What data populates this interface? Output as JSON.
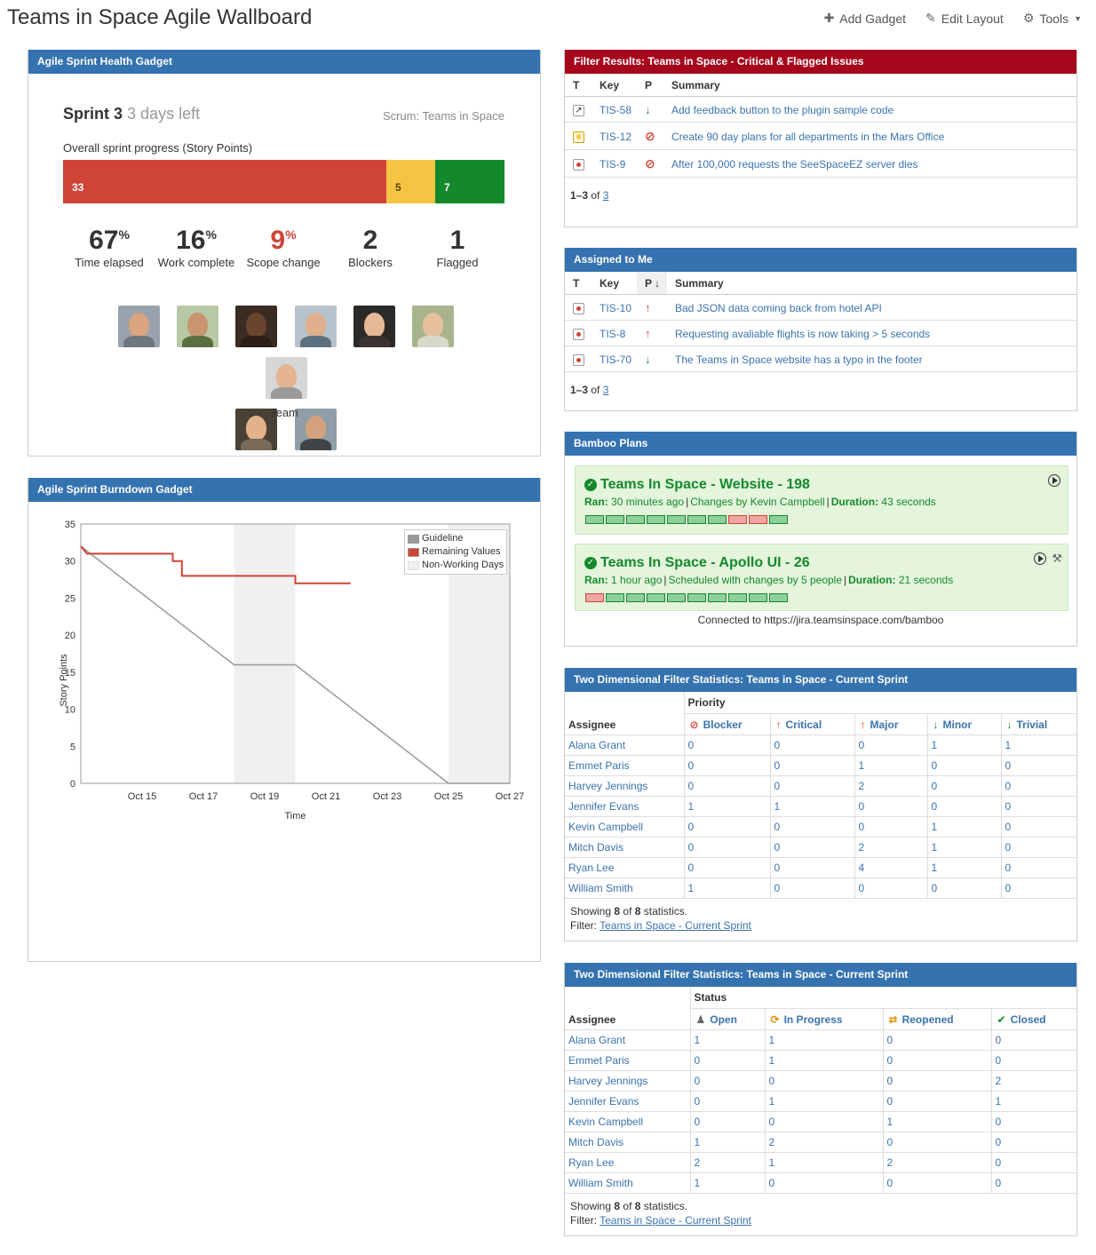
{
  "page": {
    "title": "Teams in Space Agile Wallboard",
    "actions": [
      {
        "icon": "plus-icon",
        "label": "Add Gadget"
      },
      {
        "icon": "pencil-icon",
        "label": "Edit Layout"
      },
      {
        "icon": "gear-icon",
        "label": "Tools"
      }
    ]
  },
  "health": {
    "header": "Agile Sprint Health Gadget",
    "sprint": "Sprint 3",
    "days_left": "3 days left",
    "board": "Scrum: Teams in Space",
    "progress_label": "Overall sprint progress (Story Points)",
    "progress": {
      "todo": 33,
      "in_progress": 5,
      "done": 7
    },
    "progress_colors": {
      "todo": "#d04437",
      "in_progress": "#f6c342",
      "done": "#14892c"
    },
    "stats": [
      {
        "value": "67",
        "unit": "%",
        "label": "Time elapsed"
      },
      {
        "value": "16",
        "unit": "%",
        "label": "Work complete"
      },
      {
        "value": "9",
        "unit": "%",
        "label": "Scope change"
      },
      {
        "value": "2",
        "unit": "",
        "label": "Blockers"
      },
      {
        "value": "1",
        "unit": "",
        "label": "Flagged"
      }
    ],
    "team_label": "Team"
  },
  "burndown": {
    "header": "Agile Sprint Burndown Gadget",
    "legend": [
      "Guideline",
      "Remaining Values",
      "Non-Working Days"
    ]
  },
  "chart_data": {
    "type": "line",
    "xlabel": "Time",
    "ylabel": "Story Points",
    "ylim": [
      0,
      35
    ],
    "yticks": [
      0,
      5,
      10,
      15,
      20,
      25,
      30,
      35
    ],
    "xticks": [
      "Oct 15",
      "Oct 17",
      "Oct 19",
      "Oct 21",
      "Oct 23",
      "Oct 25",
      "Oct 27"
    ],
    "x_start": "Oct 13",
    "x_end": "Oct 27",
    "non_working_days": [
      [
        "Oct 18",
        "Oct 20"
      ],
      [
        "Oct 25",
        "Oct 27"
      ]
    ],
    "series": [
      {
        "name": "Guideline",
        "color": "#999999",
        "points": [
          [
            "Oct 13",
            32
          ],
          [
            "Oct 18",
            16
          ],
          [
            "Oct 20",
            16
          ],
          [
            "Oct 25",
            0
          ],
          [
            "Oct 27",
            0
          ]
        ]
      },
      {
        "name": "Remaining Values",
        "color": "#d04437",
        "points": [
          [
            "Oct 13",
            32
          ],
          [
            "Oct 13.2",
            31
          ],
          [
            "Oct 16",
            31
          ],
          [
            "Oct 16",
            30
          ],
          [
            "Oct 16.3",
            30
          ],
          [
            "Oct 16.3",
            28
          ],
          [
            "Oct 20",
            28
          ],
          [
            "Oct 20",
            27
          ],
          [
            "Oct 21.8",
            27
          ]
        ]
      }
    ]
  },
  "filter_results": {
    "header": "Filter Results: Teams in Space - Critical & Flagged Issues",
    "columns": [
      "T",
      "Key",
      "P",
      "Summary"
    ],
    "rows": [
      {
        "type": "improvement",
        "key": "TIS-58",
        "priority": "minor",
        "summary": "Add feedback button to the plugin sample code"
      },
      {
        "type": "idea",
        "key": "TIS-12",
        "priority": "blocker",
        "summary": "Create 90 day plans for all departments in the Mars Office"
      },
      {
        "type": "bug",
        "key": "TIS-9",
        "priority": "blocker",
        "summary": "After 100,000 requests the SeeSpaceEZ server dies"
      }
    ],
    "pager_range": "1–3",
    "pager_of": "of",
    "pager_total": "3"
  },
  "assigned": {
    "header": "Assigned to Me",
    "columns": [
      "T",
      "Key",
      "P",
      "Summary"
    ],
    "rows": [
      {
        "type": "bug",
        "key": "TIS-10",
        "priority": "major",
        "summary": "Bad JSON data coming back from hotel API"
      },
      {
        "type": "bug",
        "key": "TIS-8",
        "priority": "major",
        "summary": "Requesting avaliable flights is now taking > 5 seconds"
      },
      {
        "type": "bug",
        "key": "TIS-70",
        "priority": "minor",
        "summary": "The Teams in Space website has a typo in the footer"
      }
    ],
    "pager_range": "1–3",
    "pager_of": "of",
    "pager_total": "3"
  },
  "bamboo": {
    "header": "Bamboo Plans",
    "plans": [
      {
        "title": "Teams In Space - Website - 198",
        "ran_label": "Ran:",
        "ran": "30 minutes ago",
        "changes": "Changes by Kevin Campbell",
        "duration_label": "Duration:",
        "duration": "43 seconds",
        "builds": [
          "ok",
          "ok",
          "ok",
          "ok",
          "ok",
          "ok",
          "ok",
          "fail",
          "fail",
          "ok"
        ]
      },
      {
        "title": "Teams In Space - Apollo UI - 26",
        "ran_label": "Ran:",
        "ran": "1 hour ago",
        "changes": "Scheduled with changes by 5 people",
        "duration_label": "Duration:",
        "duration": "21 seconds",
        "builds": [
          "fail",
          "ok",
          "ok",
          "ok",
          "ok",
          "ok",
          "ok",
          "ok",
          "ok",
          "ok"
        ]
      }
    ],
    "footer": "Connected to https://jira.teamsinspace.com/bamboo"
  },
  "stats_priority": {
    "header": "Two Dimensional Filter Statistics: Teams in Space - Current Sprint",
    "group_label": "Priority",
    "assignee_label": "Assignee",
    "columns": [
      "Blocker",
      "Critical",
      "Major",
      "Minor",
      "Trivial"
    ],
    "rows": [
      {
        "name": "Alana Grant",
        "values": [
          "0",
          "0",
          "0",
          "1",
          "1"
        ]
      },
      {
        "name": "Emmet Paris",
        "values": [
          "0",
          "0",
          "1",
          "0",
          "0"
        ]
      },
      {
        "name": "Harvey Jennings",
        "values": [
          "0",
          "0",
          "2",
          "0",
          "0"
        ]
      },
      {
        "name": "Jennifer Evans",
        "values": [
          "1",
          "1",
          "0",
          "0",
          "0"
        ]
      },
      {
        "name": "Kevin Campbell",
        "values": [
          "0",
          "0",
          "0",
          "1",
          "0"
        ]
      },
      {
        "name": "Mitch Davis",
        "values": [
          "0",
          "0",
          "2",
          "1",
          "0"
        ]
      },
      {
        "name": "Ryan Lee",
        "values": [
          "0",
          "0",
          "4",
          "1",
          "0"
        ]
      },
      {
        "name": "William Smith",
        "values": [
          "1",
          "0",
          "0",
          "0",
          "0"
        ]
      }
    ],
    "showing_pre": "Showing",
    "showing_n": "8",
    "showing_of": "of",
    "showing_total": "8",
    "showing_post": "statistics.",
    "filter_label": "Filter:",
    "filter_link": "Teams in Space - Current Sprint"
  },
  "stats_status": {
    "header": "Two Dimensional Filter Statistics: Teams in Space - Current Sprint",
    "group_label": "Status",
    "assignee_label": "Assignee",
    "columns": [
      "Open",
      "In Progress",
      "Reopened",
      "Closed"
    ],
    "rows": [
      {
        "name": "Alana Grant",
        "values": [
          "1",
          "1",
          "0",
          "0"
        ]
      },
      {
        "name": "Emmet Paris",
        "values": [
          "0",
          "1",
          "0",
          "0"
        ]
      },
      {
        "name": "Harvey Jennings",
        "values": [
          "0",
          "0",
          "0",
          "2"
        ]
      },
      {
        "name": "Jennifer Evans",
        "values": [
          "0",
          "1",
          "0",
          "1"
        ]
      },
      {
        "name": "Kevin Campbell",
        "values": [
          "0",
          "0",
          "1",
          "0"
        ]
      },
      {
        "name": "Mitch Davis",
        "values": [
          "1",
          "2",
          "0",
          "0"
        ]
      },
      {
        "name": "Ryan Lee",
        "values": [
          "2",
          "1",
          "2",
          "0"
        ]
      },
      {
        "name": "William Smith",
        "values": [
          "1",
          "0",
          "0",
          "0"
        ]
      }
    ],
    "showing_pre": "Showing",
    "showing_n": "8",
    "showing_of": "of",
    "showing_total": "8",
    "showing_post": "statistics.",
    "filter_label": "Filter:",
    "filter_link": "Teams in Space - Current Sprint"
  }
}
